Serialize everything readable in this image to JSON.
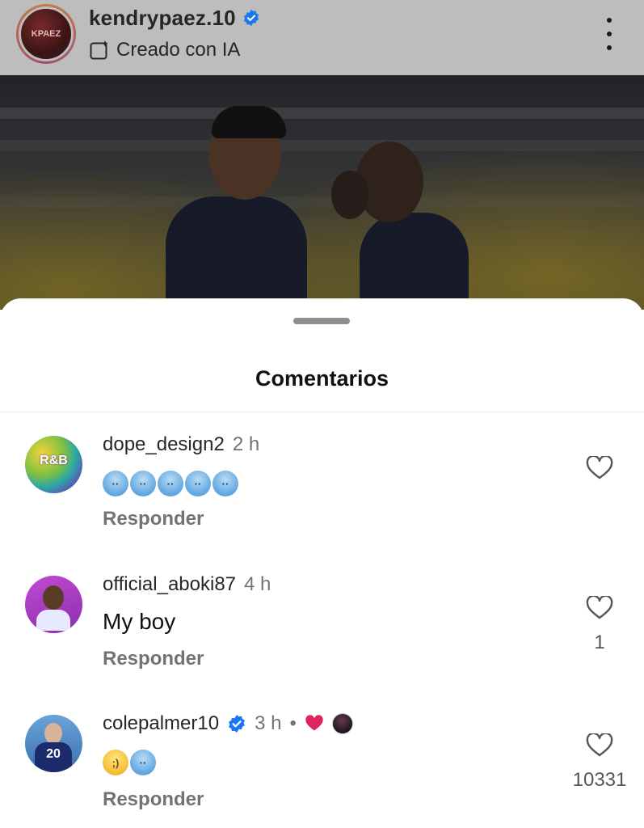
{
  "post": {
    "username": "kendrypaez.10",
    "ai_label": "Creado con IA",
    "avatar_text": "KPAEZ"
  },
  "sheet": {
    "title": "Comentarios"
  },
  "comments": [
    {
      "username": "dope_design2",
      "time": "2 h",
      "body": "🥶🥶🥶🥶🥶",
      "reply": "Responder",
      "likes": "",
      "avatar_text": "R&B"
    },
    {
      "username": "official_aboki87",
      "time": "4 h",
      "body": "My boy",
      "reply": "Responder",
      "likes": "1",
      "avatar_text": ""
    },
    {
      "username": "colepalmer10",
      "time": "3 h",
      "separator": "•",
      "body": "😉🥶",
      "reply": "Responder",
      "likes": "10331",
      "avatar_text": "20"
    }
  ],
  "colors": {
    "verified": "#1877f2",
    "heart_red": "#e0245e",
    "muted": "#737373"
  }
}
